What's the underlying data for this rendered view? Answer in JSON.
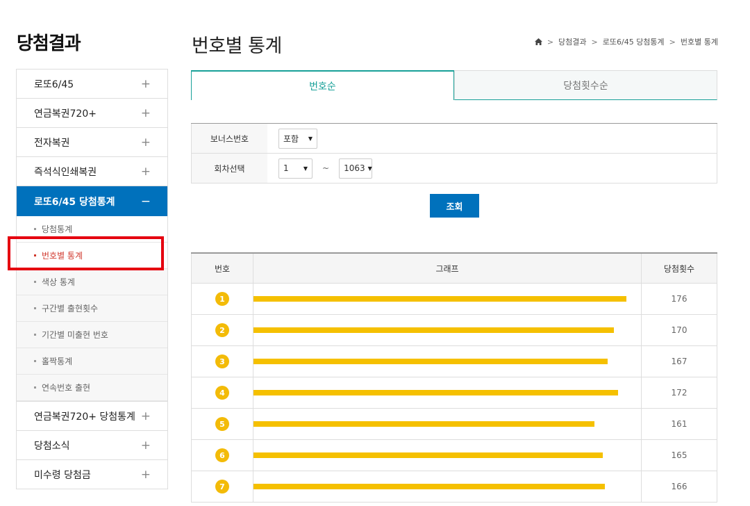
{
  "sidebar": {
    "title": "당첨결과",
    "items": [
      {
        "label": "로또6/45",
        "sign": "+"
      },
      {
        "label": "연금복권720+",
        "sign": "+"
      },
      {
        "label": "전자복권",
        "sign": "+"
      },
      {
        "label": "즉석식인쇄복권",
        "sign": "+"
      },
      {
        "label": "로또6/45 당첨통계",
        "sign": "−"
      }
    ],
    "sub_items": [
      {
        "label": "당첨통계"
      },
      {
        "label": "번호별 통계"
      },
      {
        "label": "색상 통계"
      },
      {
        "label": "구간별 출현횟수"
      },
      {
        "label": "기간별 미출현 번호"
      },
      {
        "label": "홀짝통계"
      },
      {
        "label": "연속번호 출현"
      }
    ],
    "items_after": [
      {
        "label": "연금복권720+ 당첨통계",
        "sign": "+"
      },
      {
        "label": "당첨소식",
        "sign": "+"
      },
      {
        "label": "미수령 당첨금",
        "sign": "+"
      }
    ]
  },
  "header": {
    "title": "번호별 통계",
    "breadcrumb": [
      "당첨결과",
      "로또6/45 당첨통계",
      "번호별 통계"
    ],
    "sep": ">"
  },
  "tabs": [
    {
      "label": "번호순"
    },
    {
      "label": "당첨횟수순"
    }
  ],
  "filter": {
    "bonus_label": "보너스번호",
    "bonus_value": "포함",
    "round_label": "회차선택",
    "round_from": "1",
    "round_tilde": "~",
    "round_to": "1063",
    "arrow": "▼",
    "search_label": "조회"
  },
  "table": {
    "headers": {
      "num": "번호",
      "graph": "그래프",
      "count": "당첨횟수"
    },
    "max_count": 176,
    "rows": [
      {
        "num": "1",
        "count": 176
      },
      {
        "num": "2",
        "count": 170
      },
      {
        "num": "3",
        "count": 167
      },
      {
        "num": "4",
        "count": 172
      },
      {
        "num": "5",
        "count": 161
      },
      {
        "num": "6",
        "count": 165
      },
      {
        "num": "7",
        "count": 166
      }
    ],
    "bar_color": "#f5c000"
  },
  "colors": {
    "primary": "#0071bc",
    "tab_accent": "#17a098",
    "ball": "#f3bb08",
    "highlight": "#e5000f"
  }
}
